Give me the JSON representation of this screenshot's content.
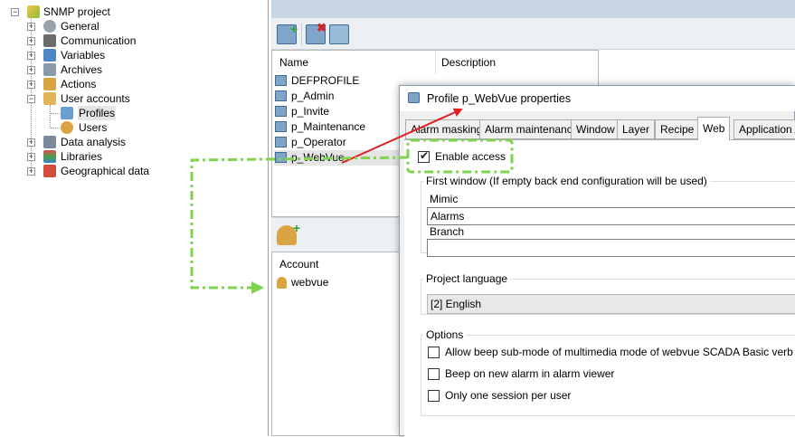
{
  "tree": {
    "root_label": "SNMP project",
    "items": [
      {
        "label": "General"
      },
      {
        "label": "Communication"
      },
      {
        "label": "Variables"
      },
      {
        "label": "Archives"
      },
      {
        "label": "Actions"
      },
      {
        "label": "User accounts"
      },
      {
        "label": "Profiles"
      },
      {
        "label": "Users"
      },
      {
        "label": "Data analysis"
      },
      {
        "label": "Libraries"
      },
      {
        "label": "Geographical data"
      }
    ]
  },
  "profiles": {
    "col_name": "Name",
    "col_description": "Description",
    "rows": [
      "DEFPROFILE",
      "p_Admin",
      "p_Invite",
      "p_Maintenance",
      "p_Operator",
      "p_WebVue"
    ],
    "selected": "p_WebVue"
  },
  "accounts": {
    "col_account": "Account",
    "rows": [
      "webvue"
    ]
  },
  "dialog": {
    "title": "Profile p_WebVue properties",
    "tabs": [
      "Alarm masking",
      "Alarm maintenance",
      "Window",
      "Layer",
      "Recipe",
      "Web",
      "Application A"
    ],
    "active_tab": "Web",
    "enable_access_label": "Enable access",
    "enable_access_checked": true,
    "first_window_title": "First window (If empty back end configuration will be used)",
    "mimic_label": "Mimic",
    "mimic_value": "Alarms",
    "branch_label": "Branch",
    "branch_value": "",
    "project_language_title": "Project language",
    "project_language_value": "[2] English",
    "options_title": "Options",
    "options": [
      {
        "label": "Allow beep sub-mode of multimedia mode of webvue SCADA Basic verb",
        "checked": false
      },
      {
        "label": "Beep on new alarm in alarm viewer",
        "checked": false
      },
      {
        "label": "Only one session per user",
        "checked": false
      }
    ]
  },
  "colors": {
    "highlight_dash": "#7fd34e",
    "arrow_red": "#e02020",
    "selection_bg": "#e5e5e5"
  }
}
